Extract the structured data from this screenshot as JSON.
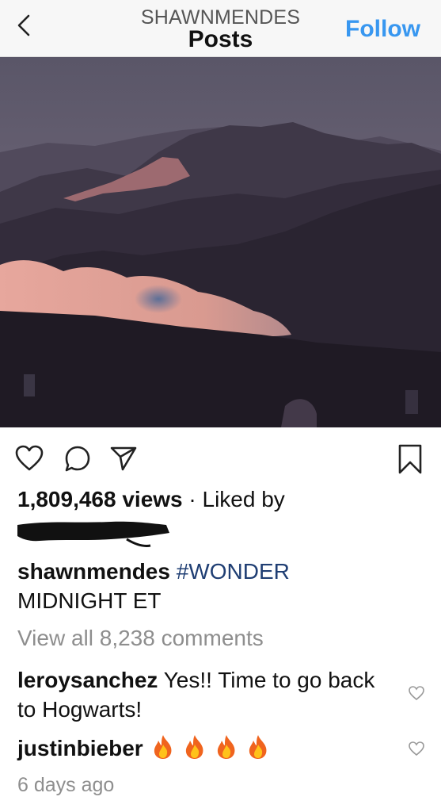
{
  "header": {
    "username": "SHAWNMENDES",
    "title": "Posts",
    "follow_label": "Follow"
  },
  "post": {
    "views_count": "1,809,468 views",
    "liked_by_text": "· Liked by",
    "caption_user": "shawnmendes",
    "caption_hashtag": "#WONDER",
    "caption_rest": "MIDNIGHT ET",
    "view_all_comments": "View all 8,238 comments",
    "timestamp": "6 days ago"
  },
  "comments": [
    {
      "user": "leroysanchez",
      "text": "Yes!! Time to go back to Hogwarts!"
    },
    {
      "user": "justinbieber",
      "text": "",
      "emoji": [
        "fire",
        "fire",
        "fire",
        "fire"
      ]
    }
  ],
  "icons": {
    "back": "chevron-left-icon",
    "like": "heart-icon",
    "comment": "comment-bubble-icon",
    "share": "paper-plane-icon",
    "save": "bookmark-icon",
    "flame": "fire-emoji-icon"
  },
  "colors": {
    "accent": "#3897f0",
    "hashtag": "#1f3e73",
    "muted": "#8e8e8e"
  }
}
